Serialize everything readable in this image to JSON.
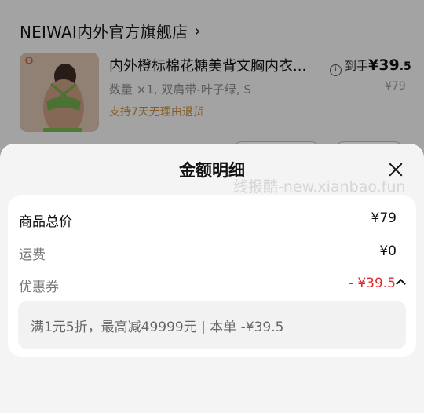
{
  "store": {
    "name": "NEIWAI内外官方旗舰店",
    "chevron": "›"
  },
  "product": {
    "title": "内外橙标棉花糖美背文胸内衣...",
    "price_label": "到手",
    "price_int": "¥39",
    "price_dec": ".5",
    "variant": "数量 ×1, 双肩带-叶子绿, S",
    "original_price": "¥79",
    "return_policy": "支持7天无理由退货",
    "thumb_icon": "product-photo"
  },
  "sheet": {
    "title": "金额明细",
    "watermark": "线报酷-new.xianbao.fun",
    "rows": [
      {
        "label": "商品总价",
        "value": "¥79"
      },
      {
        "label": "运费",
        "value": "¥0"
      },
      {
        "label": "优惠券",
        "value": "- ¥39.5"
      }
    ],
    "coupon_detail": "满1元5折，最高减49999元 | 本单 -¥39.5"
  },
  "colors": {
    "accent_red": "#e02b2b",
    "policy_gold": "#c58a35"
  }
}
